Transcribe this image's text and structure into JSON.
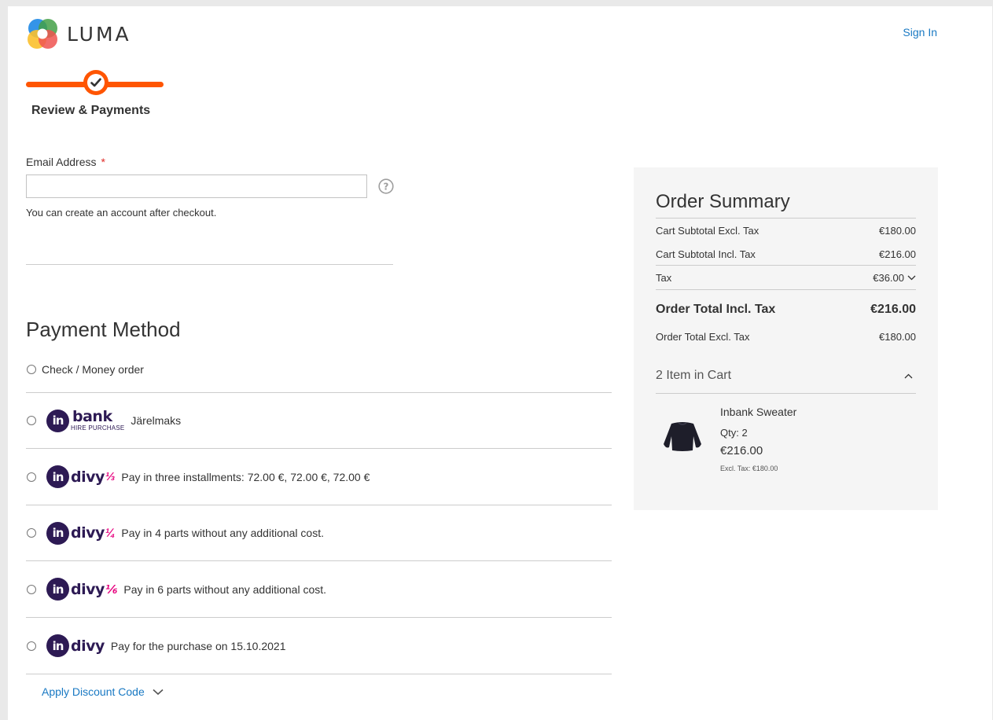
{
  "header": {
    "logo_text": "LUMA",
    "sign_in": "Sign In"
  },
  "progress": {
    "step_label": "Review & Payments"
  },
  "email": {
    "label": "Email Address",
    "required_mark": "*",
    "value": "",
    "placeholder": "",
    "note": "You can create an account after checkout."
  },
  "payment": {
    "title": "Payment Method",
    "methods": [
      {
        "label": "Check / Money order"
      },
      {
        "brand": "bank",
        "brand_sub": "HIRE PURCHASE",
        "label": "Järelmaks"
      },
      {
        "brand": "divy",
        "fraction": "⅓",
        "label": "Pay in three installments: 72.00 €, 72.00 €, 72.00 €"
      },
      {
        "brand": "divy",
        "fraction": "¼",
        "label": "Pay in 4 parts without any additional cost."
      },
      {
        "brand": "divy",
        "fraction": "⅙",
        "label": "Pay in 6 parts without any additional cost."
      },
      {
        "brand": "divy",
        "fraction": "",
        "label": "Pay for the purchase on 15.10.2021"
      }
    ],
    "in_mark": "in",
    "discount_label": "Apply Discount Code"
  },
  "summary": {
    "title": "Order Summary",
    "rows": [
      {
        "label": "Cart Subtotal Excl. Tax",
        "value": "€180.00"
      },
      {
        "label": "Cart Subtotal Incl. Tax",
        "value": "€216.00"
      },
      {
        "label": "Tax",
        "value": "€36.00"
      },
      {
        "label": "Order Total Incl. Tax",
        "value": "€216.00"
      },
      {
        "label": "Order Total Excl. Tax",
        "value": "€180.00"
      }
    ],
    "cart_label": "2 Item in Cart",
    "item": {
      "name": "Inbank Sweater",
      "qty": "Qty: 2",
      "price": "€216.00",
      "excl": "Excl. Tax: €180.00"
    }
  },
  "colors": {
    "accent_orange": "#ff5501",
    "link_blue": "#1979c3",
    "inbank_purple": "#2d1a54",
    "divy_pink": "#e6007e"
  }
}
